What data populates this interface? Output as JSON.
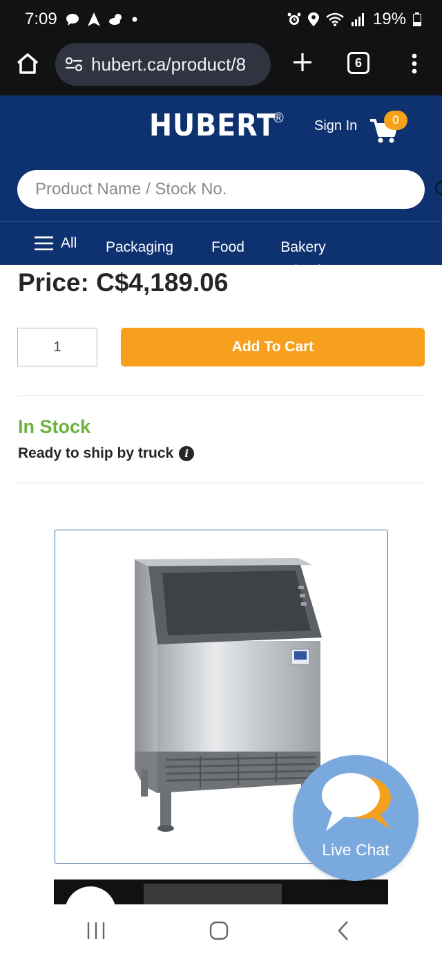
{
  "status_bar": {
    "time": "7:09",
    "battery": "19%",
    "icons": [
      "chat-bubble-icon",
      "navigation-icon",
      "weather-icon",
      "dot-icon",
      "alarm-icon",
      "location-icon",
      "wifi-icon",
      "signal-icon",
      "battery-icon"
    ]
  },
  "browser": {
    "url": "hubert.ca/product/8",
    "tab_count": "6"
  },
  "header": {
    "logo": "HUBERT",
    "logo_mark": "®",
    "sign_in": "Sign In",
    "cart_count": "0",
    "search_placeholder": "Product Name / Stock No."
  },
  "nav": {
    "all_label": "All",
    "items": [
      "Packaging",
      "Food Storage",
      "Bakery Packaging"
    ]
  },
  "product": {
    "price": "Price: C$4,189.06",
    "quantity": "1",
    "add_to_cart": "Add To Cart",
    "stock_status": "In Stock",
    "shipping": "Ready to ship by truck"
  },
  "live_chat": {
    "label": "Live Chat"
  },
  "colors": {
    "header_blue": "#0e3170",
    "accent_orange": "#f7a01d",
    "stock_green": "#6cb33e",
    "chat_blue": "#7aa9de"
  }
}
